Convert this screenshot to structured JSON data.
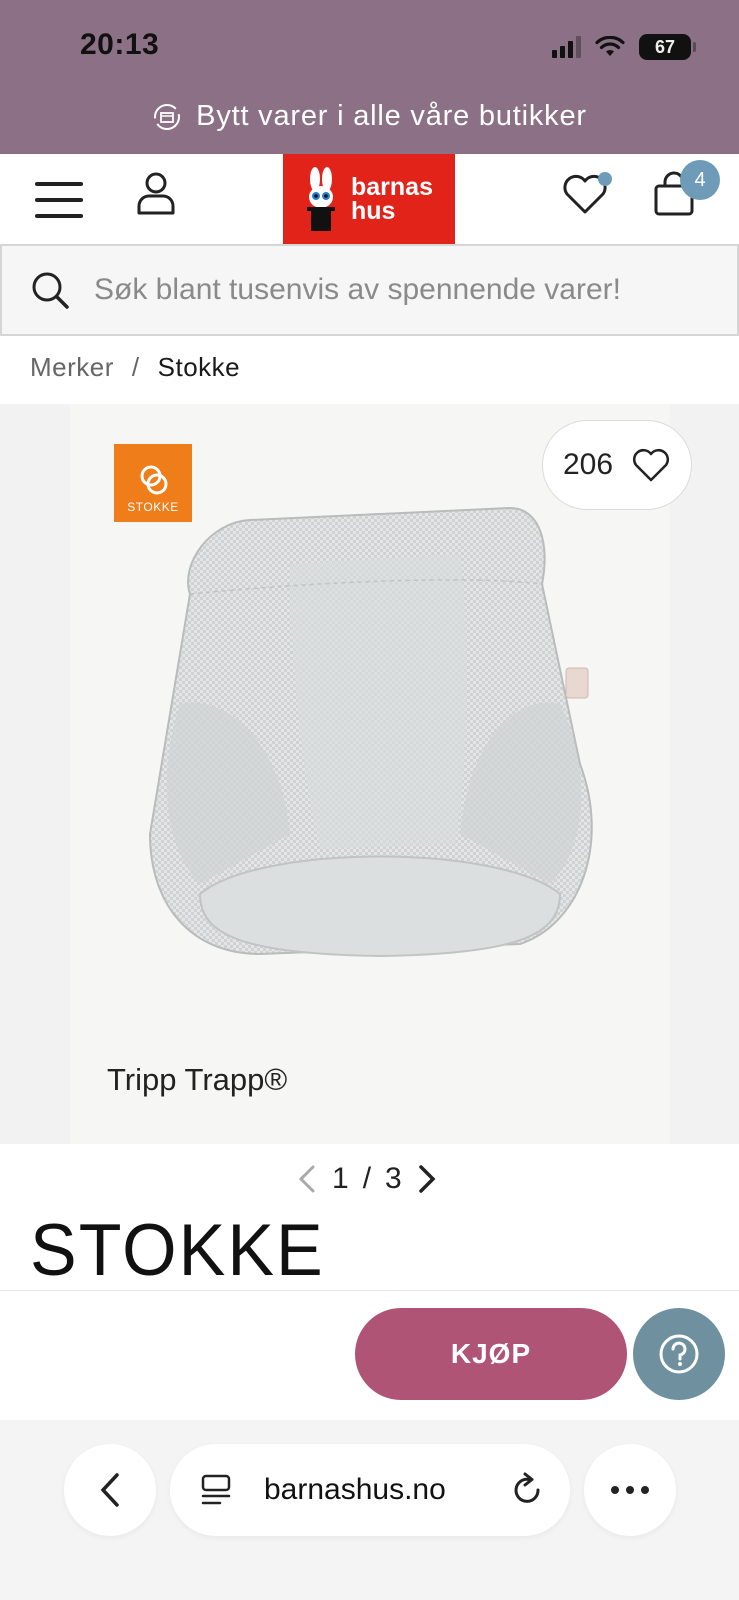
{
  "status_bar": {
    "time": "20:13",
    "battery": "67"
  },
  "promo": {
    "text": "Bytt varer i alle våre butikker"
  },
  "header": {
    "logo_line1": "barnas",
    "logo_line2": "hus",
    "cart_count": "4"
  },
  "search": {
    "placeholder": "Søk blant tusenvis av spennende varer!"
  },
  "breadcrumb": {
    "parent": "Merker",
    "separator": "/",
    "current": "Stokke"
  },
  "product": {
    "brand_badge_text": "STOKKE",
    "likes": "206",
    "caption": "Tripp Trapp®",
    "image_index": "1",
    "image_separator": "/",
    "image_total": "3",
    "brand_wordmark": "STOKKE"
  },
  "actions": {
    "buy_label": "KJØP"
  },
  "browser": {
    "url": "barnashus.no"
  },
  "colors": {
    "banner": "#8b7086",
    "logo_red": "#e2231a",
    "buy": "#b05475",
    "help": "#6f909f",
    "badge_blue": "#6e9bb8",
    "stokke_orange": "#ef7d1a"
  }
}
